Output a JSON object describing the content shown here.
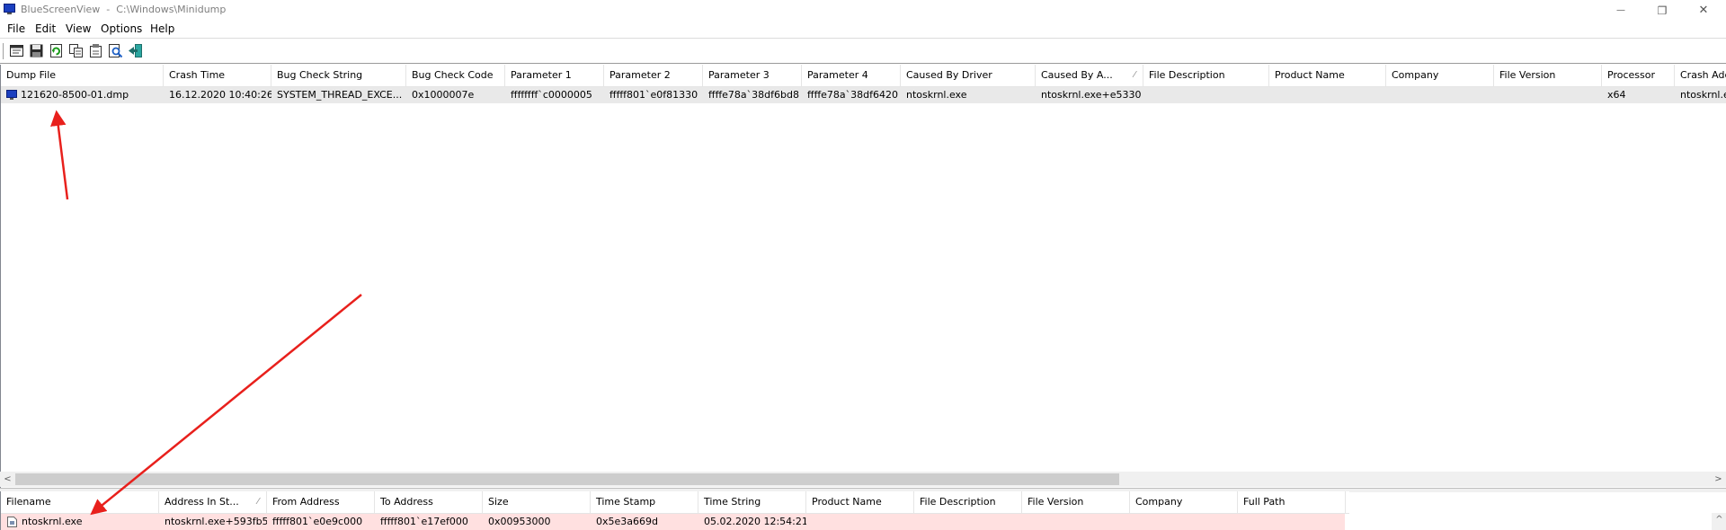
{
  "window": {
    "app_name": "BlueScreenView",
    "title_separator": "  -  ",
    "path": "C:\\Windows\\Minidump",
    "minimize_glyph": "—",
    "restore_glyph": "❐",
    "close_glyph": "✕"
  },
  "menu": {
    "items": [
      "File",
      "Edit",
      "View",
      "Options",
      "Help"
    ]
  },
  "toolbar": {
    "buttons": [
      "properties-icon",
      "save-icon",
      "refresh-icon",
      "copy-icon",
      "advanced-options-icon",
      "find-icon",
      "exit-icon"
    ]
  },
  "top_table": {
    "columns": [
      "Dump File",
      "Crash Time",
      "Bug Check String",
      "Bug Check Code",
      "Parameter 1",
      "Parameter 2",
      "Parameter 3",
      "Parameter 4",
      "Caused By Driver",
      "Caused By A...",
      "File Description",
      "Product Name",
      "Company",
      "File Version",
      "Processor",
      "Crash Add"
    ],
    "sort_indicator": "⁄",
    "rows": [
      [
        "121620-8500-01.dmp",
        "16.12.2020 10:40:26",
        "SYSTEM_THREAD_EXCE...",
        "0x1000007e",
        "ffffffff`c0000005",
        "fffff801`e0f81330",
        "ffffe78a`38df6bd8",
        "ffffe78a`38df6420",
        "ntoskrnl.exe",
        "ntoskrnl.exe+e5330",
        "",
        "",
        "",
        "",
        "x64",
        "ntoskrnl.e"
      ]
    ]
  },
  "scrollbar": {
    "left_arrow": "<",
    "right_arrow": ">",
    "up_arrow": "^"
  },
  "bottom_table": {
    "columns": [
      "Filename",
      "Address In St...",
      "From Address",
      "To Address",
      "Size",
      "Time Stamp",
      "Time String",
      "Product Name",
      "File Description",
      "File Version",
      "Company",
      "Full Path"
    ],
    "sort_indicator": "⁄",
    "rows": [
      [
        "ntoskrnl.exe",
        "ntoskrnl.exe+593fb5",
        "fffff801`e0e9c000",
        "fffff801`e17ef000",
        "0x00953000",
        "0x5e3a669d",
        "05.02.2020 12:54:21",
        "",
        "",
        "",
        "",
        ""
      ]
    ]
  },
  "colors": {
    "annotation_arrow": "#e8201c",
    "selected_row": "#e9e9e9",
    "highlight_row": "#ffe0e0"
  }
}
